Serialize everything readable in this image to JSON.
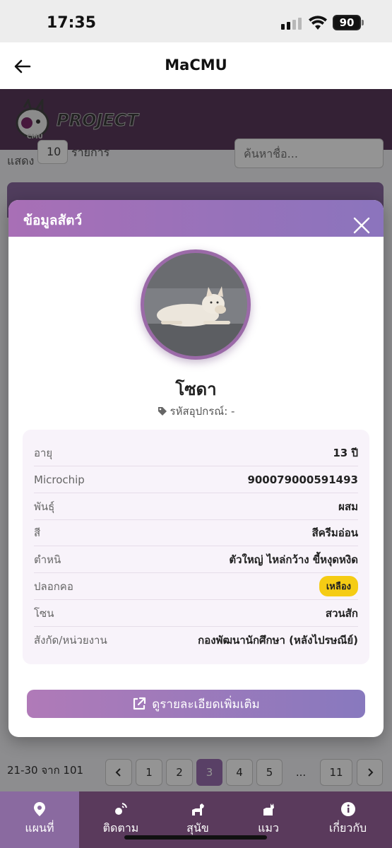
{
  "status_bar": {
    "time": "17:35",
    "battery": "90"
  },
  "nav": {
    "title": "MaCMU"
  },
  "header": {
    "logo_text": "PROJECT",
    "logo_small": "CMU"
  },
  "table_controls": {
    "show_label": "แสดง",
    "show_value": "10",
    "show_suffix": "รายการ",
    "search_placeholder": "ค้นหาชื่อ..."
  },
  "modal": {
    "title": "ข้อมูลสัตว์",
    "name": "โซดา",
    "device_label": "รหัสอุปกรณ์: -",
    "info": [
      {
        "label": "อายุ",
        "value": "13 ปี"
      },
      {
        "label": "Microchip",
        "value": "900079000591493"
      },
      {
        "label": "พันธุ์",
        "value": "ผสม"
      },
      {
        "label": "สี",
        "value": "สีครีมอ่อน"
      },
      {
        "label": "ตำหนิ",
        "value": "ตัวใหญ่ ไหล่กว้าง ขี้หงุดหงิด"
      },
      {
        "label": "ปลอกคอ",
        "value": "เหลือง"
      },
      {
        "label": "โซน",
        "value": "สวนสัก"
      },
      {
        "label": "สังกัด/หน่วยงาน",
        "value": "กองพัฒนานักศึกษา (หลังไปรษณีย์)"
      }
    ],
    "detail_button": "ดูรายละเอียดเพิ่มเติม",
    "collar_color": "#f5cc14"
  },
  "pagination": {
    "info": "21-30 จาก 101",
    "pages": [
      "1",
      "2",
      "3",
      "4",
      "5",
      "...",
      "11"
    ],
    "current": "3"
  },
  "tabbar": {
    "items": [
      {
        "label": "แผนที่",
        "icon": "map-pin-icon"
      },
      {
        "label": "ติดตาม",
        "icon": "tracking-icon"
      },
      {
        "label": "สุนัข",
        "icon": "dog-icon"
      },
      {
        "label": "แมว",
        "icon": "cat-icon"
      },
      {
        "label": "เกี่ยวกับ",
        "icon": "info-icon"
      }
    ],
    "active": "แผนที่"
  },
  "colors": {
    "accent": "#8a6aa0",
    "header": "#5a3a5c",
    "modal_gradient_start": "#a86fb6",
    "modal_gradient_end": "#8b74bd"
  }
}
